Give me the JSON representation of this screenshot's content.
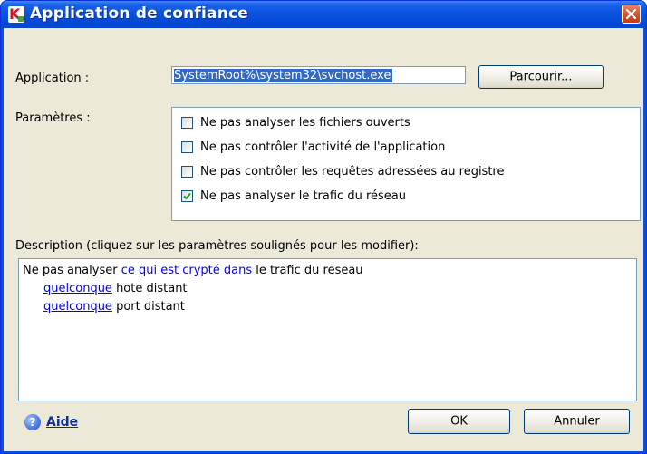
{
  "window": {
    "title": "Application de confiance",
    "titlebar_color": "#0a53de",
    "close_tooltip": "close"
  },
  "form": {
    "application_label": "Application :",
    "application_value": "SystemRoot%\\system32\\svchost.exe",
    "browse_button": "Parcourir...",
    "params_label": "Paramètres :"
  },
  "params": [
    {
      "label": "Ne pas analyser les fichiers ouverts",
      "checked": false
    },
    {
      "label": "Ne pas contrôler l'activité de l'application",
      "checked": false
    },
    {
      "label": "Ne pas contrôler les requêtes adressées au registre",
      "checked": false
    },
    {
      "label": "Ne pas analyser le trafic du réseau",
      "checked": true
    }
  ],
  "description": {
    "label": "Description (cliquez sur les paramètres soulignés pour les modifier):",
    "line1_prefix": "Ne pas analyser ",
    "line1_link": "ce qui est crypté dans",
    "line1_suffix": " le trafic du reseau",
    "line2_link": "quelconque",
    "line2_suffix": " hote distant",
    "line3_link": "quelconque",
    "line3_suffix": " port distant"
  },
  "footer": {
    "help_label": "Aide",
    "ok_label": "OK",
    "cancel_label": "Annuler"
  },
  "icons": {
    "app_logo": "kaspersky-logo-icon",
    "close": "close-icon",
    "help": "help-icon",
    "check": "checkmark-icon"
  },
  "colors": {
    "accent": "#316ac5",
    "link": "#0000ff",
    "check": "#21a121",
    "dialog_bg": "#ece9d8"
  }
}
